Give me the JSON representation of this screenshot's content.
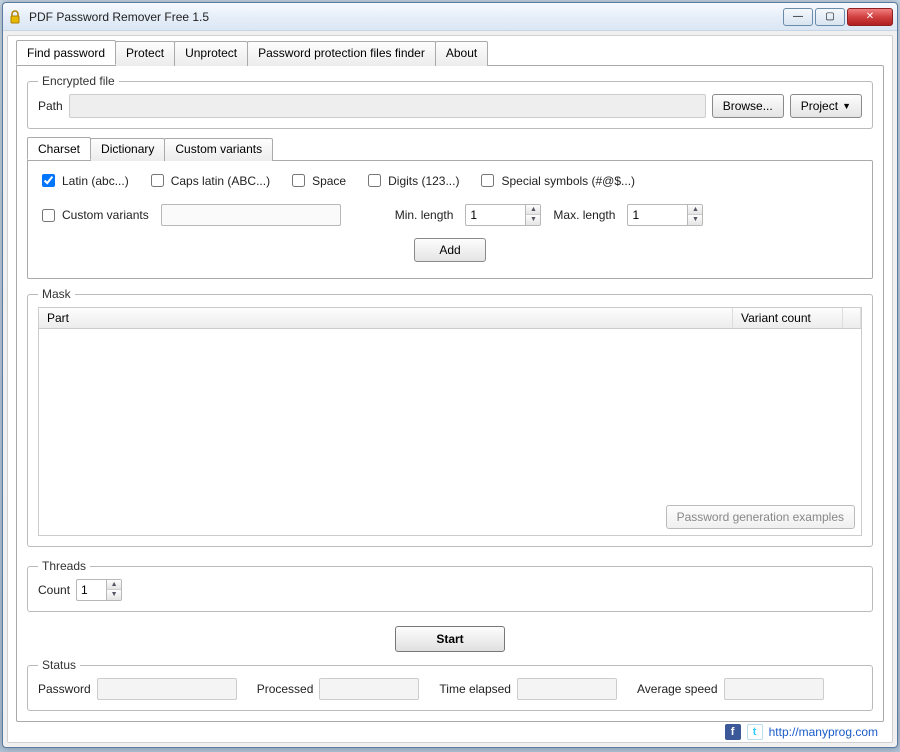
{
  "window": {
    "title": "PDF Password Remover Free 1.5"
  },
  "tabs": [
    "Find password",
    "Protect",
    "Unprotect",
    "Password protection files finder",
    "About"
  ],
  "active_tab": 0,
  "encrypted": {
    "legend": "Encrypted file",
    "path_label": "Path",
    "path_value": "",
    "browse": "Browse...",
    "project": "Project"
  },
  "charset": {
    "tabs": [
      "Charset",
      "Dictionary",
      "Custom variants"
    ],
    "active": 0,
    "latin": "Latin (abc...)",
    "caps": "Caps latin (ABC...)",
    "space": "Space",
    "digits": "Digits (123...)",
    "special": "Special symbols (#@$...)",
    "custom": "Custom variants",
    "custom_val": "",
    "min_label": "Min. length",
    "min_val": "1",
    "max_label": "Max. length",
    "max_val": "1",
    "add": "Add"
  },
  "mask": {
    "legend": "Mask",
    "col_part": "Part",
    "col_variant": "Variant count",
    "examples": "Password generation examples"
  },
  "threads": {
    "legend": "Threads",
    "count_label": "Count",
    "count_val": "1"
  },
  "start": "Start",
  "status": {
    "legend": "Status",
    "password": "Password",
    "processed": "Processed",
    "elapsed": "Time elapsed",
    "speed": "Average speed"
  },
  "footer": {
    "url": "http://manyprog.com"
  }
}
